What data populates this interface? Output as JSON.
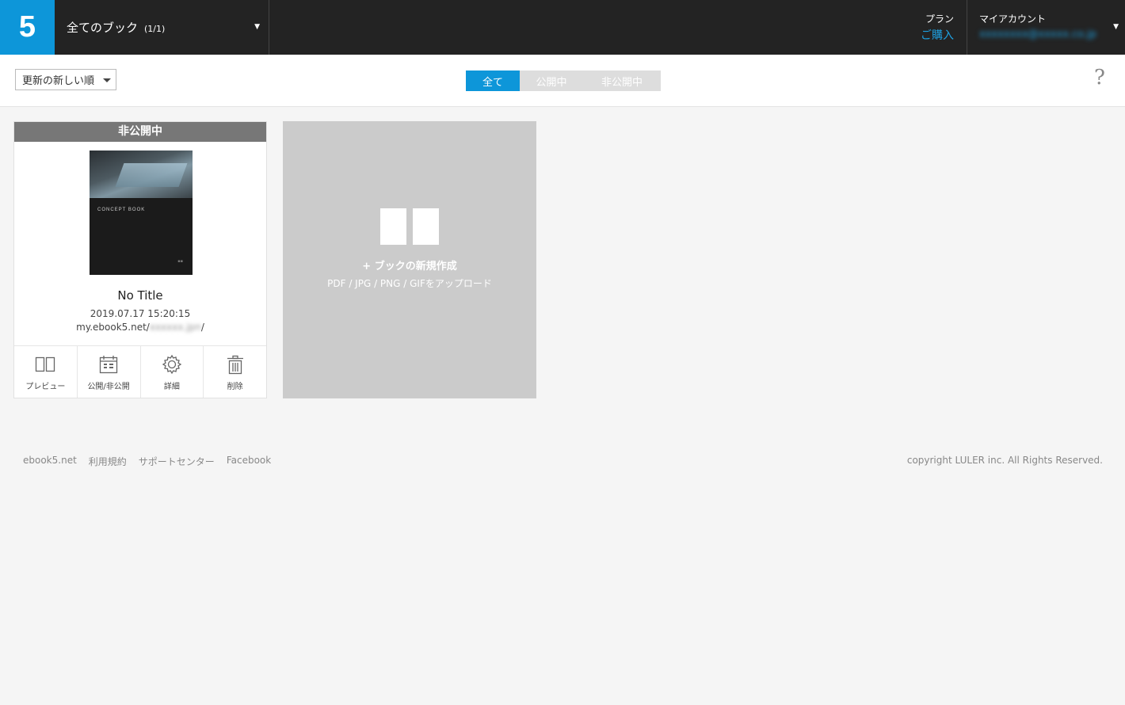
{
  "header": {
    "logo": "5",
    "book_select_title": "全てのブック",
    "book_select_count": "(1/1)",
    "plan_label": "プラン",
    "plan_link": "ご購入",
    "account_label": "マイアカウント",
    "account_email": "xxxxxxxx@xxxxx.co.jp"
  },
  "toolbar": {
    "sort_value": "更新の新しい順",
    "filter_tabs": [
      {
        "label": "全て",
        "active": true
      },
      {
        "label": "公開中",
        "active": false
      },
      {
        "label": "非公開中",
        "active": false
      }
    ],
    "help": "?"
  },
  "book": {
    "status": "非公開中",
    "cover_title": "CONCEPT BOOK",
    "title": "No Title",
    "date": "2019.07.17 15:20:15",
    "url_prefix": "my.ebook5.net/",
    "url_hidden": "xxxxxx.jpn",
    "url_suffix": "/",
    "actions": [
      {
        "label": "プレビュー",
        "icon": "preview-icon"
      },
      {
        "label": "公開/非公開",
        "icon": "publish-icon"
      },
      {
        "label": "詳細",
        "icon": "gear-icon"
      },
      {
        "label": "削除",
        "icon": "trash-icon"
      }
    ]
  },
  "new_book": {
    "label": "+ ブックの新規作成",
    "formats": "PDF / JPG / PNG / GIFをアップロード"
  },
  "footer": {
    "links": [
      "ebook5.net",
      "利用規約",
      "サポートセンター",
      "Facebook"
    ],
    "copyright": "copyright LULER inc. All Rights Reserved."
  },
  "colors": {
    "accent": "#0d96d9",
    "header_bg": "#232323",
    "status_bg": "#777777",
    "new_tile_bg": "#cbcbcb"
  }
}
